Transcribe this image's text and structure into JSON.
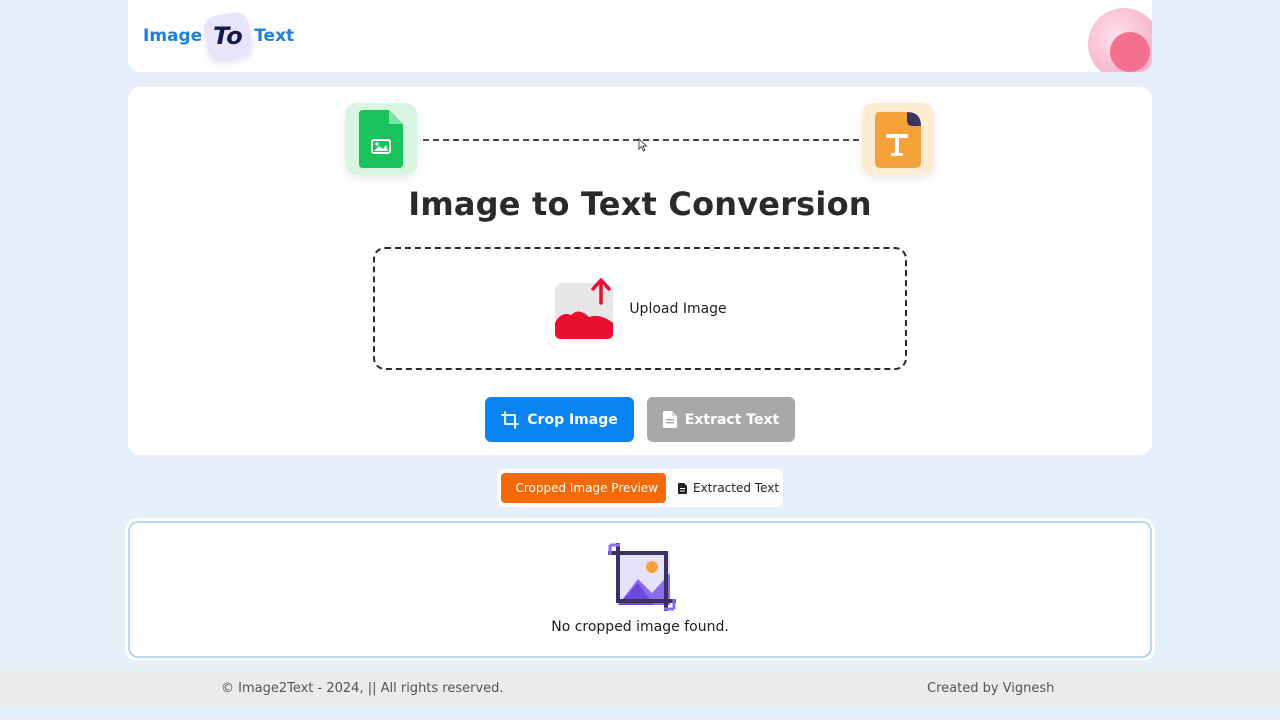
{
  "header": {
    "logo_left": "Image",
    "logo_badge": "To",
    "logo_right": "Text"
  },
  "main": {
    "title": "Image to Text Conversion",
    "upload_label": "Upload Image",
    "crop_button": "Crop Image",
    "extract_button": "Extract Text"
  },
  "tabs": [
    {
      "label": "Cropped Image Preview",
      "active": true,
      "icon": "image-icon"
    },
    {
      "label": "Extracted Text",
      "active": false,
      "icon": "document-icon"
    }
  ],
  "preview": {
    "empty_message": "No cropped image found."
  },
  "footer": {
    "copyright": "© Image2Text - 2024, || All rights reserved.",
    "credit": "Created by Vignesh"
  },
  "colors": {
    "brand_blue": "#1e7fe0",
    "crop_button": "#0a84f0",
    "extract_button_disabled": "#a8a8a8",
    "active_tab": "#f56a07",
    "page_background": "#e6eef9"
  }
}
